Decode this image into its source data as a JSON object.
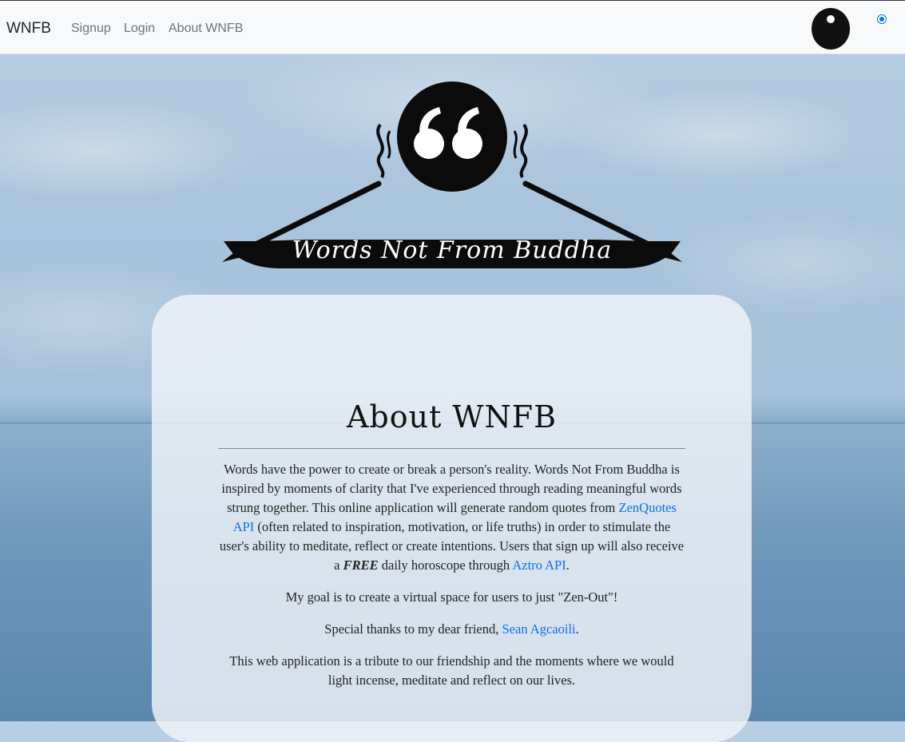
{
  "navbar": {
    "brand": "WNFB",
    "links": [
      "Signup",
      "Login",
      "About WNFB"
    ]
  },
  "logo": {
    "text": "Words Not From Buddha"
  },
  "about": {
    "title": "About WNFB",
    "p1": {
      "before_link1": "Words have the power to create or break a person's reality. Words Not From Buddha is inspired by moments of clarity that I've experienced through reading meaningful words strung together. This online application will generate random quotes from ",
      "link1": "ZenQuotes API",
      "between": " (often related to inspiration, motivation, or life truths) in order to stimulate the user's ability to meditate, reflect or create intentions. Users that sign up will also receive a ",
      "emphasis": "FREE",
      "after_emphasis": " daily horoscope through ",
      "link2": "Aztro API",
      "end": "."
    },
    "p2": "My goal is to create a virtual space for users to just \"Zen-Out\"!",
    "p3": {
      "before_link": "Special thanks to my dear friend, ",
      "link": "Sean Agcaoili",
      "end": "."
    },
    "p4": "This web application is a tribute to our friendship and the moments where we would light incense, meditate and reflect on our lives."
  },
  "colors": {
    "link": "#0d6efd",
    "navbar_bg": "#f8f9fa",
    "toggle": "#111111"
  }
}
